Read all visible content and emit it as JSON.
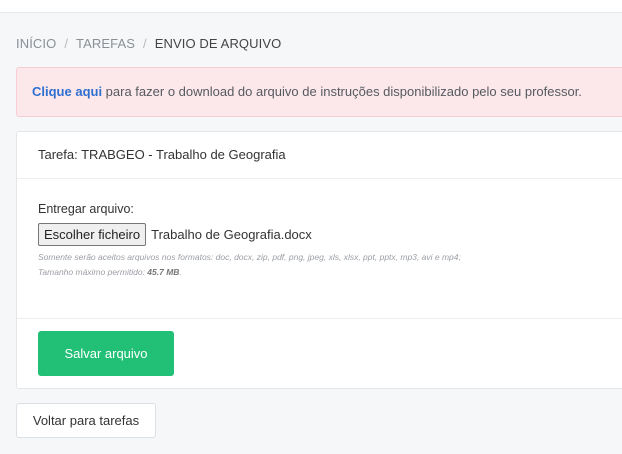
{
  "breadcrumb": {
    "home": "INÍCIO",
    "tasks": "TAREFAS",
    "current": "ENVIO DE ARQUIVO"
  },
  "alert": {
    "link_text": "Clique aqui",
    "message": " para fazer o download do arquivo de instruções disponibilizado pelo seu professor."
  },
  "task": {
    "title": "Tarefa: TRABGEO - Trabalho de Geografia"
  },
  "upload": {
    "label": "Entregar arquivo:",
    "choose_button": "Escolher ficheiro",
    "selected_file": "Trabalho de Geografia.docx",
    "formats_note": "Somente serão aceitos arquivos nos formatos: doc, docx, zip, pdf, png, jpeg, xls, xlsx, ppt, pptx, mp3, avi e mp4;",
    "max_size_prefix": "Tamanho máximo permitido: ",
    "max_size_value": "45.7 MB",
    "max_size_suffix": "."
  },
  "actions": {
    "save_label": "Salvar arquivo",
    "back_label": "Voltar para tarefas"
  },
  "colors": {
    "alert_bg": "#fce8ea",
    "link": "#2f6fd0",
    "save_button": "#22c077"
  }
}
